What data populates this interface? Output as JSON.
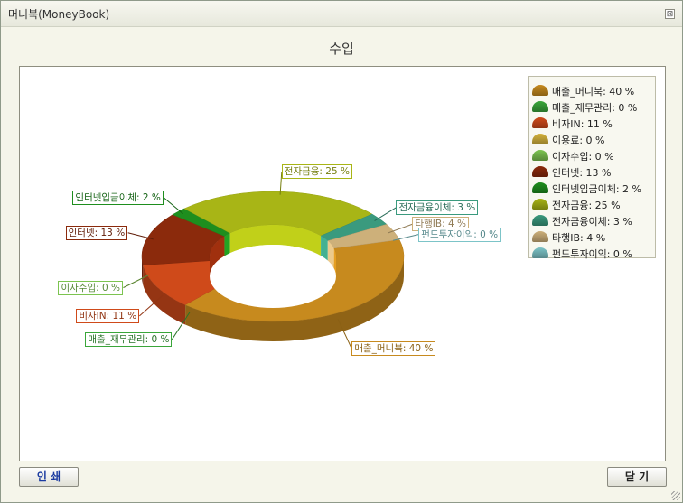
{
  "window": {
    "title": "머니북(MoneyBook)",
    "close_glyph": "⊠"
  },
  "chart_data": {
    "type": "pie",
    "style": "3d-donut",
    "title": "수입",
    "categories": [
      "매출_머니북",
      "매출_재무관리",
      "비자IN",
      "이용료",
      "이자수입",
      "인터넷",
      "인터넷입금이체",
      "전자금융",
      "전자금융이체",
      "타행IB",
      "펀드투자이익"
    ],
    "values": [
      40,
      0,
      11,
      0,
      0,
      13,
      2,
      25,
      3,
      4,
      0
    ],
    "unit": "%",
    "colors": [
      "#c78a1e",
      "#3aa63a",
      "#cf4a1a",
      "#d4b23c",
      "#7cc450",
      "#8b2a0c",
      "#1e8e1e",
      "#a8b516",
      "#3a9a7e",
      "#cdb07a",
      "#7cc4c8"
    ],
    "legend_position": "top-right",
    "slice_labels": [
      "매출_머니북: 40 %",
      "매출_재무관리: 0 %",
      "비자IN: 11 %",
      "이용료: 0 %",
      "이자수입: 0 %",
      "인터넷: 13 %",
      "인터넷입금이체: 2 %",
      "전자금융: 25 %",
      "전자금융이체: 3 %",
      "타행IB: 4 %",
      "펀드투자이익: 0 %"
    ]
  },
  "footer": {
    "print_label": "인 쇄",
    "close_label": "닫 기"
  }
}
